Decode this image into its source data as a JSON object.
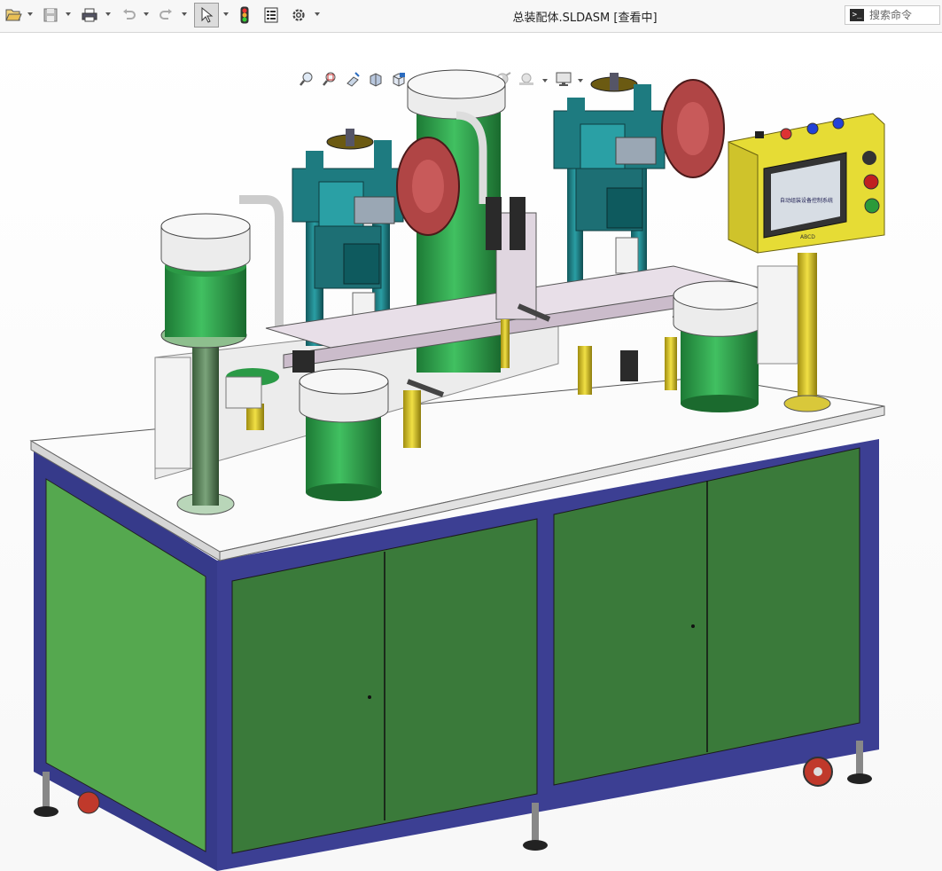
{
  "window": {
    "title": "总装配体.SLDASM [查看中]"
  },
  "search": {
    "placeholder": "搜索命令",
    "prompt_glyph": ">_"
  },
  "toolbar": {
    "items": [
      "open-icon",
      "save-icon",
      "print-icon",
      "undo-icon",
      "redo-icon",
      "select-icon",
      "traffic-light-icon",
      "file-properties-icon",
      "options-gear-icon"
    ]
  },
  "headsup_toolbar": {
    "items": [
      "zoom-to-fit-icon",
      "zoom-to-area-icon",
      "previous-view-icon",
      "section-view-icon",
      "view-orientation-icon",
      "display-style-icon",
      "hide-show-icon",
      "edit-appearance-icon",
      "apply-scene-icon",
      "view-settings-icon"
    ]
  },
  "hmi_panel": {
    "screen_text": "自动组装设备控制系统",
    "badge_text": "ABCD"
  },
  "colors": {
    "cabinet_frame": "#3c3f93",
    "cabinet_door": "#3e8a3e",
    "table_top": "#fbfbfb",
    "bowl_green": "#2fa24a",
    "press_teal": "#1e7b80",
    "pulley_red": "#b23a3a",
    "hmi_yellow": "#e6dc35",
    "column_yellow": "#c9b41a"
  }
}
